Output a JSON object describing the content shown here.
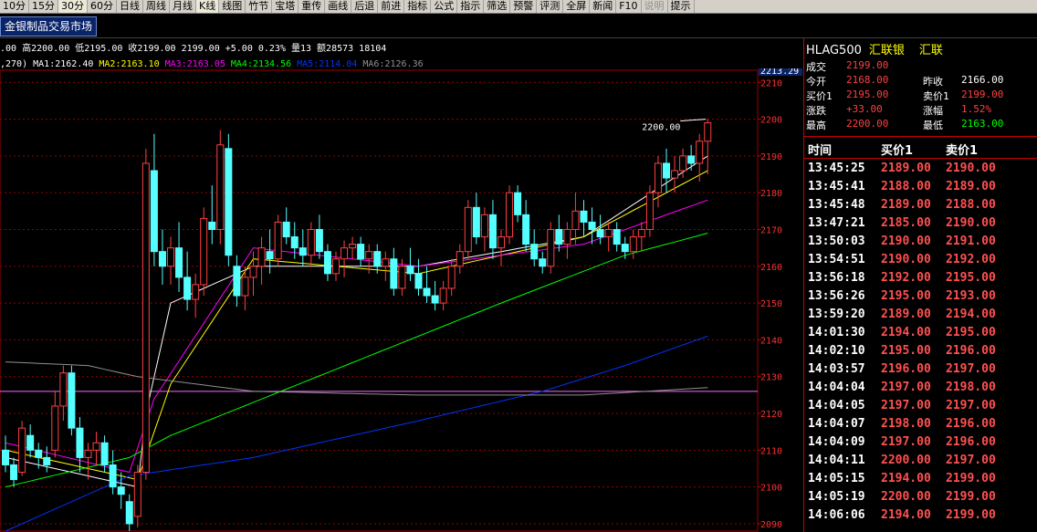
{
  "toolbar": [
    {
      "label": "10分",
      "active": false,
      "disabled": false
    },
    {
      "label": "15分",
      "active": false,
      "disabled": false
    },
    {
      "label": "30分",
      "active": true,
      "disabled": false
    },
    {
      "label": "60分",
      "active": false,
      "disabled": false
    },
    {
      "label": "日线",
      "active": false,
      "disabled": false
    },
    {
      "label": "周线",
      "active": false,
      "disabled": false
    },
    {
      "label": "月线",
      "active": false,
      "disabled": false
    },
    {
      "label": "K线",
      "active": true,
      "disabled": false
    },
    {
      "label": "线图",
      "active": false,
      "disabled": false
    },
    {
      "label": "竹节",
      "active": false,
      "disabled": false
    },
    {
      "label": "宝塔",
      "active": false,
      "disabled": false
    },
    {
      "label": "重传",
      "active": false,
      "disabled": false
    },
    {
      "label": "画线",
      "active": false,
      "disabled": false
    },
    {
      "label": "后退",
      "active": false,
      "disabled": false
    },
    {
      "label": "前进",
      "active": false,
      "disabled": false
    },
    {
      "label": "指标",
      "active": false,
      "disabled": false
    },
    {
      "label": "公式",
      "active": false,
      "disabled": false
    },
    {
      "label": "指示",
      "active": false,
      "disabled": false
    },
    {
      "label": "筛选",
      "active": false,
      "disabled": false
    },
    {
      "label": "预警",
      "active": false,
      "disabled": false
    },
    {
      "label": "评测",
      "active": false,
      "disabled": false
    },
    {
      "label": "全屏",
      "active": false,
      "disabled": false
    },
    {
      "label": "新闻",
      "active": false,
      "disabled": false
    },
    {
      "label": "F10",
      "active": false,
      "disabled": false
    },
    {
      "label": "说明",
      "active": false,
      "disabled": true
    },
    {
      "label": "提示",
      "active": false,
      "disabled": false
    }
  ],
  "market_tab": "金银制品交易市场",
  "quote_line": ".00 高2200.00 低2195.00 收2199.00 2199.00 +5.00 0.23% 量13 额28573 18104",
  "ma_line": [
    {
      "text": ",270)",
      "color": "#ffffff"
    },
    {
      "text": " MA1:2162.40",
      "color": "#ffffff"
    },
    {
      "text": " MA2:2163.10",
      "color": "#ffff00"
    },
    {
      "text": " MA3:2163.05",
      "color": "#ff00ff"
    },
    {
      "text": " MA4:2134.56",
      "color": "#00ff00"
    },
    {
      "text": " MA5:2114.04",
      "color": "#0033ff"
    },
    {
      "text": " MA6:2126.36",
      "color": "#909090"
    }
  ],
  "right_panel": {
    "code": "HLAG500",
    "name": "汇联银",
    "tag": "汇联",
    "info": [
      {
        "l1": "成交",
        "v1": "2199.00",
        "c1": "#ff4040",
        "l2": "",
        "v2": "",
        "c2": "#ffffff"
      },
      {
        "l1": "今开",
        "v1": "2168.00",
        "c1": "#ff4040",
        "l2": "昨收",
        "v2": "2166.00",
        "c2": "#ffffff"
      },
      {
        "l1": "买价1",
        "v1": "2195.00",
        "c1": "#ff4040",
        "l2": "卖价1",
        "v2": "2199.00",
        "c2": "#ff4040"
      },
      {
        "l1": "涨跌",
        "v1": "+33.00",
        "c1": "#ff4040",
        "l2": "涨幅",
        "v2": "1.52%",
        "c2": "#ff4040"
      },
      {
        "l1": "最高",
        "v1": "2200.00",
        "c1": "#ff4040",
        "l2": "最低",
        "v2": "2163.00",
        "c2": "#00ff00"
      }
    ],
    "ticks_header": {
      "time": "时间",
      "bid": "买价1",
      "ask": "卖价1"
    },
    "ticks": [
      {
        "time": "13:45:25",
        "bid": "2189.00",
        "ask": "2190.00"
      },
      {
        "time": "13:45:41",
        "bid": "2188.00",
        "ask": "2189.00"
      },
      {
        "time": "13:45:48",
        "bid": "2189.00",
        "ask": "2188.00"
      },
      {
        "time": "13:47:21",
        "bid": "2185.00",
        "ask": "2190.00"
      },
      {
        "time": "13:50:03",
        "bid": "2190.00",
        "ask": "2191.00"
      },
      {
        "time": "13:54:51",
        "bid": "2190.00",
        "ask": "2192.00"
      },
      {
        "time": "13:56:18",
        "bid": "2192.00",
        "ask": "2195.00"
      },
      {
        "time": "13:56:26",
        "bid": "2195.00",
        "ask": "2193.00"
      },
      {
        "time": "13:59:20",
        "bid": "2189.00",
        "ask": "2194.00"
      },
      {
        "time": "14:01:30",
        "bid": "2194.00",
        "ask": "2195.00"
      },
      {
        "time": "14:02:10",
        "bid": "2195.00",
        "ask": "2196.00"
      },
      {
        "time": "14:03:57",
        "bid": "2196.00",
        "ask": "2197.00"
      },
      {
        "time": "14:04:04",
        "bid": "2197.00",
        "ask": "2198.00"
      },
      {
        "time": "14:04:05",
        "bid": "2197.00",
        "ask": "2197.00"
      },
      {
        "time": "14:04:07",
        "bid": "2198.00",
        "ask": "2196.00"
      },
      {
        "time": "14:04:09",
        "bid": "2197.00",
        "ask": "2196.00"
      },
      {
        "time": "14:04:11",
        "bid": "2200.00",
        "ask": "2197.00"
      },
      {
        "time": "14:05:15",
        "bid": "2194.00",
        "ask": "2199.00"
      },
      {
        "time": "14:05:19",
        "bid": "2200.00",
        "ask": "2199.00"
      },
      {
        "time": "14:06:06",
        "bid": "2194.00",
        "ask": "2199.00"
      }
    ]
  },
  "chart_data": {
    "type": "candlestick",
    "price_label": "2213.29",
    "max_annotation": "2200.00",
    "y_ticks": [
      2090,
      2100,
      2110,
      2120,
      2130,
      2140,
      2150,
      2160,
      2170,
      2180,
      2190,
      2200,
      2210
    ],
    "ylim": [
      2088,
      2213.29
    ],
    "grid": true,
    "reference_level": 2126,
    "candles": [
      [
        2110,
        2114,
        2104,
        2106
      ],
      [
        2106,
        2108,
        2100,
        2102
      ],
      [
        2104,
        2118,
        2103,
        2116
      ],
      [
        2114,
        2117,
        2108,
        2110
      ],
      [
        2110,
        2112,
        2105,
        2108
      ],
      [
        2108,
        2111,
        2104,
        2106
      ],
      [
        2110,
        2126,
        2108,
        2122
      ],
      [
        2122,
        2133,
        2118,
        2131
      ],
      [
        2131,
        2133,
        2114,
        2116
      ],
      [
        2116,
        2119,
        2104,
        2108
      ],
      [
        2108,
        2112,
        2102,
        2110
      ],
      [
        2110,
        2115,
        2106,
        2112
      ],
      [
        2112,
        2114,
        2104,
        2106
      ],
      [
        2106,
        2110,
        2098,
        2100
      ],
      [
        2100,
        2104,
        2094,
        2098
      ],
      [
        2096,
        2098,
        2088,
        2090
      ],
      [
        2092,
        2106,
        2089,
        2104
      ],
      [
        2104,
        2192,
        2102,
        2188
      ],
      [
        2186,
        2196,
        2160,
        2164
      ],
      [
        2164,
        2170,
        2155,
        2160
      ],
      [
        2160,
        2168,
        2155,
        2165
      ],
      [
        2165,
        2172,
        2153,
        2157
      ],
      [
        2157,
        2164,
        2148,
        2151
      ],
      [
        2151,
        2158,
        2146,
        2155
      ],
      [
        2155,
        2176,
        2152,
        2173
      ],
      [
        2172,
        2182,
        2166,
        2170
      ],
      [
        2170,
        2197,
        2166,
        2193
      ],
      [
        2192,
        2196,
        2160,
        2163
      ],
      [
        2160,
        2163,
        2149,
        2152
      ],
      [
        2152,
        2160,
        2148,
        2157
      ],
      [
        2157,
        2164,
        2152,
        2160
      ],
      [
        2160,
        2168,
        2155,
        2165
      ],
      [
        2164,
        2170,
        2158,
        2162
      ],
      [
        2162,
        2174,
        2160,
        2172
      ],
      [
        2172,
        2176,
        2166,
        2168
      ],
      [
        2168,
        2172,
        2162,
        2165
      ],
      [
        2165,
        2170,
        2160,
        2163
      ],
      [
        2163,
        2172,
        2160,
        2170
      ],
      [
        2170,
        2174,
        2162,
        2164
      ],
      [
        2164,
        2166,
        2156,
        2158
      ],
      [
        2158,
        2164,
        2156,
        2162
      ],
      [
        2162,
        2167,
        2157,
        2165
      ],
      [
        2165,
        2168,
        2162,
        2166
      ],
      [
        2166,
        2168,
        2160,
        2162
      ],
      [
        2162,
        2166,
        2158,
        2164
      ],
      [
        2164,
        2166,
        2158,
        2160
      ],
      [
        2160,
        2164,
        2156,
        2162
      ],
      [
        2162,
        2165,
        2152,
        2154
      ],
      [
        2154,
        2162,
        2152,
        2160
      ],
      [
        2160,
        2165,
        2156,
        2158
      ],
      [
        2158,
        2162,
        2152,
        2154
      ],
      [
        2154,
        2160,
        2150,
        2152
      ],
      [
        2152,
        2156,
        2148,
        2150
      ],
      [
        2150,
        2156,
        2148,
        2154
      ],
      [
        2154,
        2162,
        2152,
        2160
      ],
      [
        2160,
        2166,
        2158,
        2164
      ],
      [
        2164,
        2178,
        2162,
        2176
      ],
      [
        2176,
        2180,
        2166,
        2168
      ],
      [
        2168,
        2176,
        2164,
        2174
      ],
      [
        2174,
        2178,
        2162,
        2165
      ],
      [
        2165,
        2170,
        2160,
        2168
      ],
      [
        2168,
        2182,
        2166,
        2180
      ],
      [
        2180,
        2182,
        2172,
        2174
      ],
      [
        2174,
        2178,
        2164,
        2166
      ],
      [
        2166,
        2170,
        2160,
        2162
      ],
      [
        2162,
        2164,
        2158,
        2160
      ],
      [
        2160,
        2172,
        2158,
        2170
      ],
      [
        2170,
        2174,
        2164,
        2166
      ],
      [
        2166,
        2172,
        2162,
        2170
      ],
      [
        2170,
        2180,
        2166,
        2175
      ],
      [
        2175,
        2178,
        2168,
        2172
      ],
      [
        2172,
        2176,
        2166,
        2170
      ],
      [
        2170,
        2174,
        2166,
        2168
      ],
      [
        2168,
        2172,
        2164,
        2170
      ],
      [
        2170,
        2172,
        2164,
        2166
      ],
      [
        2166,
        2168,
        2162,
        2164
      ],
      [
        2164,
        2170,
        2162,
        2168
      ],
      [
        2168,
        2172,
        2164,
        2170
      ],
      [
        2170,
        2182,
        2168,
        2180
      ],
      [
        2180,
        2190,
        2176,
        2188
      ],
      [
        2188,
        2192,
        2180,
        2184
      ],
      [
        2184,
        2190,
        2180,
        2186
      ],
      [
        2186,
        2192,
        2184,
        2190
      ],
      [
        2190,
        2193,
        2186,
        2188
      ],
      [
        2188,
        2196,
        2183,
        2194
      ],
      [
        2194,
        2200,
        2185,
        2199
      ]
    ],
    "series": [
      {
        "name": "MA1",
        "color": "#ffffff"
      },
      {
        "name": "MA2",
        "color": "#ffff00"
      },
      {
        "name": "MA3",
        "color": "#ff00ff"
      },
      {
        "name": "MA4",
        "color": "#00ff00"
      },
      {
        "name": "MA5",
        "color": "#0033ff"
      },
      {
        "name": "MA6",
        "color": "#909090"
      }
    ],
    "ma_anchors": [
      {
        "x": [
          0,
          16,
          17,
          20,
          30,
          50,
          70,
          85
        ],
        "y": [
          2108,
          2100,
          2120,
          2150,
          2160,
          2160,
          2168,
          2190
        ]
      },
      {
        "x": [
          0,
          16,
          20,
          30,
          50,
          70,
          85
        ],
        "y": [
          2110,
          2102,
          2128,
          2162,
          2158,
          2168,
          2186
        ]
      },
      {
        "x": [
          0,
          15,
          18,
          30,
          50,
          70,
          85
        ],
        "y": [
          2112,
          2104,
          2124,
          2165,
          2160,
          2166,
          2178
        ]
      },
      {
        "x": [
          0,
          15,
          20,
          40,
          60,
          75,
          85
        ],
        "y": [
          2100,
          2108,
          2114,
          2132,
          2150,
          2163,
          2169
        ]
      },
      {
        "x": [
          0,
          15,
          30,
          50,
          65,
          75,
          85
        ],
        "y": [
          2088,
          2103,
          2108,
          2118,
          2126,
          2133,
          2141
        ]
      },
      {
        "x": [
          0,
          10,
          16,
          30,
          50,
          70,
          85
        ],
        "y": [
          2134,
          2133,
          2130,
          2126,
          2125,
          2125,
          2127
        ]
      }
    ]
  }
}
